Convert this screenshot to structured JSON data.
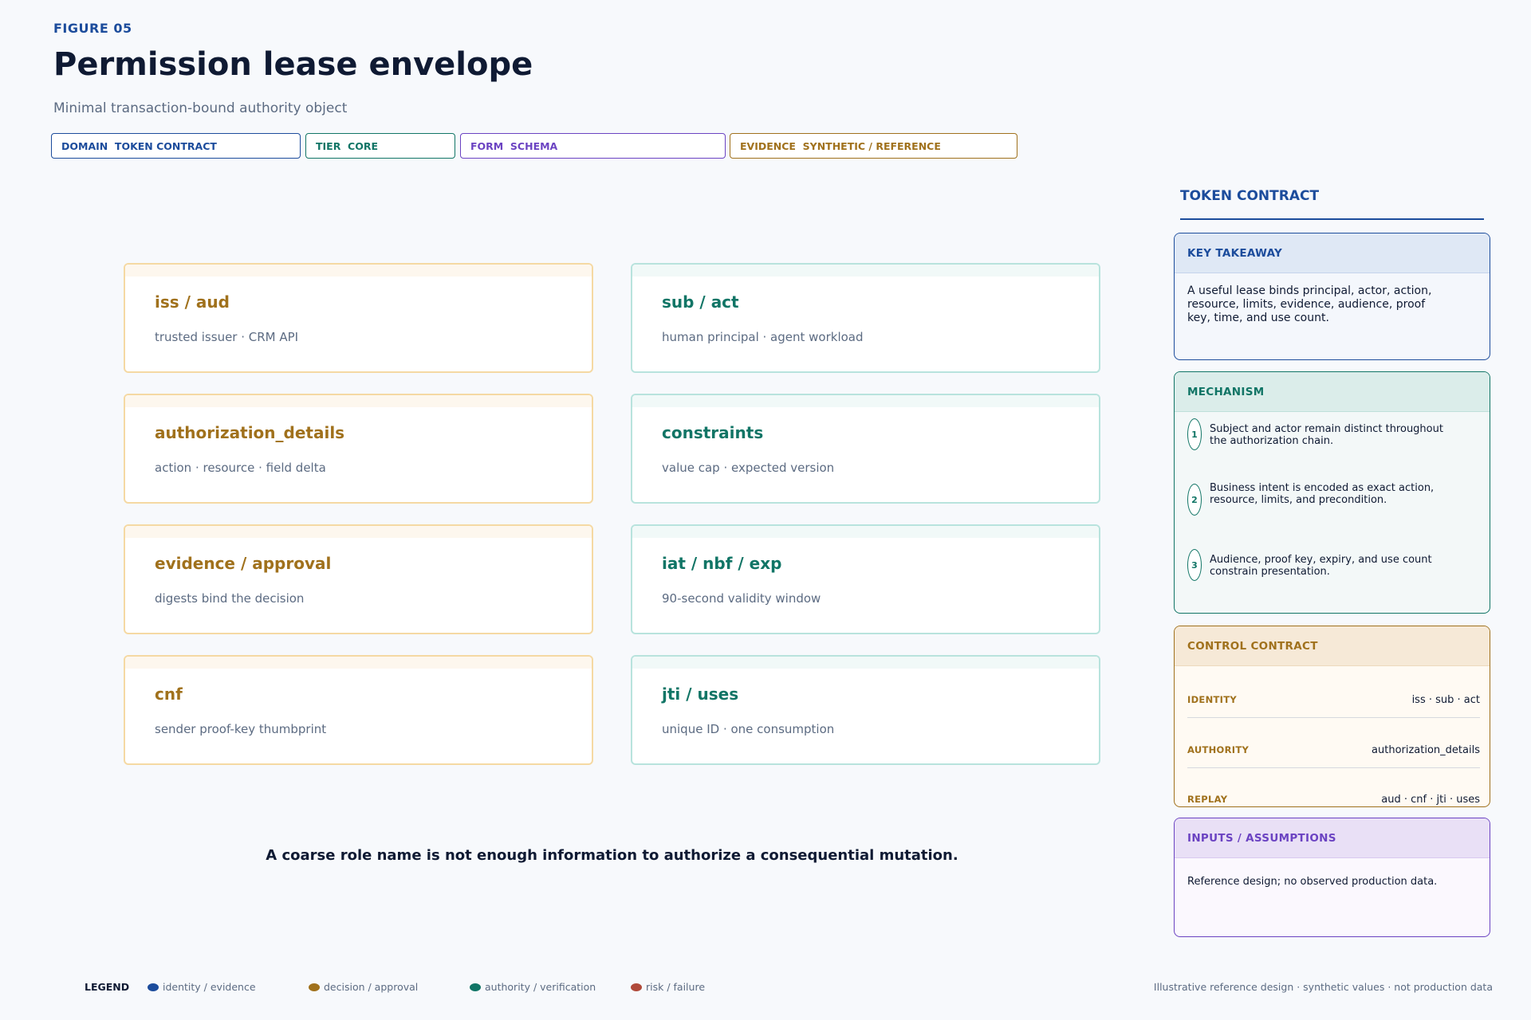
{
  "header": {
    "figure_label": "FIGURE 05",
    "title": "Permission lease envelope",
    "subtitle": "Minimal transaction-bound authority object"
  },
  "tags": {
    "domain": "DOMAIN  TOKEN CONTRACT",
    "tier": "TIER  CORE",
    "form": "FORM  SCHEMA",
    "evidence": "EVIDENCE  SYNTHETIC / REFERENCE"
  },
  "fields": [
    {
      "title": "iss / aud",
      "detail": "trusted issuer · CRM API"
    },
    {
      "title": "sub / act",
      "detail": "human principal · agent workload"
    },
    {
      "title": "authorization_details",
      "detail": "action · resource · field delta"
    },
    {
      "title": "constraints",
      "detail": "value cap · expected version"
    },
    {
      "title": "evidence / approval",
      "detail": "digests bind the decision"
    },
    {
      "title": "iat / nbf / exp",
      "detail": "90-second validity window"
    },
    {
      "title": "cnf",
      "detail": "sender proof-key thumbprint"
    },
    {
      "title": "jti / uses",
      "detail": "unique ID · one consumption"
    }
  ],
  "statement": "A coarse role name is not enough information to authorize a consequential mutation.",
  "panel": {
    "heading": "TOKEN CONTRACT",
    "key_takeaway": {
      "title": "KEY TAKEAWAY",
      "text": "A useful lease binds principal, actor, action, resource, limits, evidence, audience, proof key, time, and use count."
    },
    "mechanism": {
      "title": "MECHANISM",
      "steps": [
        {
          "num": "1",
          "text": "Subject and actor remain distinct throughout the authorization chain."
        },
        {
          "num": "2",
          "text": "Business intent is encoded as exact action, resource, limits, and precondition."
        },
        {
          "num": "3",
          "text": "Audience, proof key, expiry, and use count constrain presentation."
        }
      ]
    },
    "control_contract": {
      "title": "CONTROL CONTRACT",
      "rows": [
        {
          "key": "IDENTITY",
          "value": "iss · sub · act"
        },
        {
          "key": "AUTHORITY",
          "value": "authorization_details"
        },
        {
          "key": "REPLAY",
          "value": "aud · cnf · jti · uses"
        }
      ]
    },
    "inputs": {
      "title": "INPUTS / ASSUMPTIONS",
      "text": "Reference design; no observed production data."
    }
  },
  "legend": {
    "label": "LEGEND",
    "items": [
      {
        "label": "identity / evidence",
        "color": "#1c4c9c"
      },
      {
        "label": "decision / approval",
        "color": "#a0711c"
      },
      {
        "label": "authority / verification",
        "color": "#117566"
      },
      {
        "label": "risk / failure",
        "color": "#b04a3a"
      }
    ]
  },
  "footer_note": "Illustrative reference design · synthetic values · not production data",
  "colors": {
    "identity": "#1c4c9c",
    "decision": "#a0711c",
    "authority": "#117566",
    "form": "#6b43c2",
    "risk": "#b04a3a"
  }
}
